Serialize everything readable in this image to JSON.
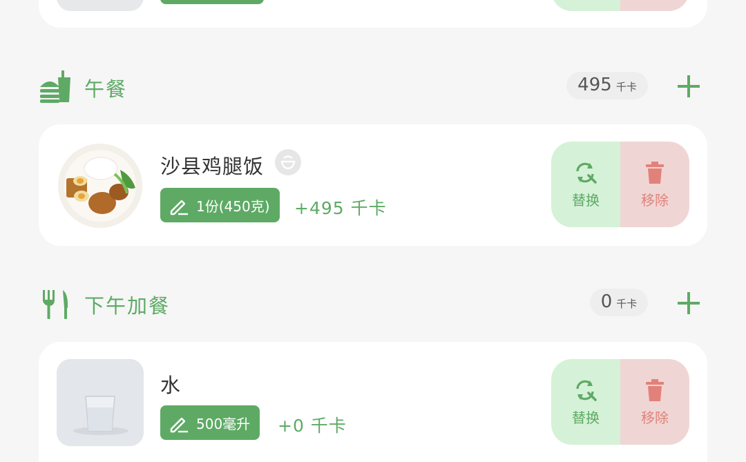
{
  "lunch": {
    "title": "午餐",
    "kcal_value": "495",
    "kcal_unit": "千卡",
    "icon": "burger-drink-icon",
    "items": [
      {
        "name": "沙县鸡腿饭",
        "badge_icon": "bowl-icon",
        "portion": "1份(450克)",
        "kcal_add": "+495 千卡",
        "replace_label": "替换",
        "remove_label": "移除"
      }
    ]
  },
  "snack": {
    "title": "下午加餐",
    "kcal_value": "0",
    "kcal_unit": "千卡",
    "icon": "fork-knife-icon",
    "items": [
      {
        "name": "水",
        "portion": "500毫升",
        "kcal_add": "+0 千卡",
        "replace_label": "替换",
        "remove_label": "移除"
      }
    ]
  },
  "colors": {
    "accent": "#5eaa65",
    "replace_bg": "#d5f1d7",
    "remove_bg": "#efd6d4",
    "remove_fg": "#e2817a",
    "page_bg": "#f6f6f6"
  }
}
